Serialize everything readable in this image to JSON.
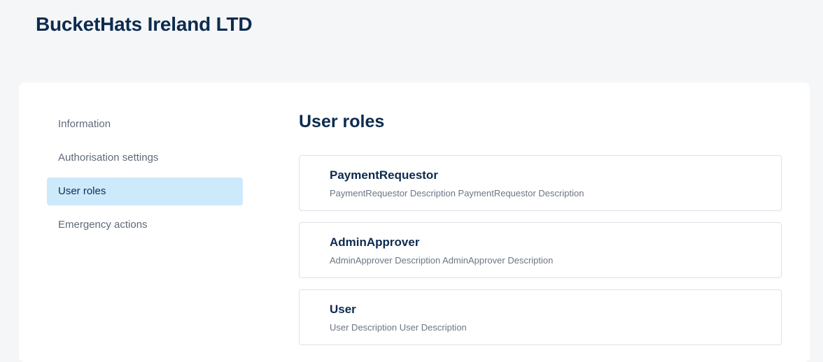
{
  "header": {
    "title": "BucketHats Ireland LTD"
  },
  "sidebar": {
    "items": [
      {
        "label": "Information",
        "active": false
      },
      {
        "label": "Authorisation settings",
        "active": false
      },
      {
        "label": "User roles",
        "active": true
      },
      {
        "label": "Emergency actions",
        "active": false
      }
    ]
  },
  "main": {
    "title": "User roles",
    "roles": [
      {
        "name": "PaymentRequestor",
        "description": "PaymentRequestor Description PaymentRequestor Description"
      },
      {
        "name": "AdminApprover",
        "description": "AdminApprover Description AdminApprover Description"
      },
      {
        "name": "User",
        "description": "User Description User Description"
      }
    ]
  },
  "colors": {
    "page_background": "#f5f6f8",
    "card_background": "#ffffff",
    "primary_text": "#0d2b4e",
    "muted_text": "#5f6b7a",
    "active_nav_background": "#cdeafd",
    "card_border": "#dde1e6"
  }
}
